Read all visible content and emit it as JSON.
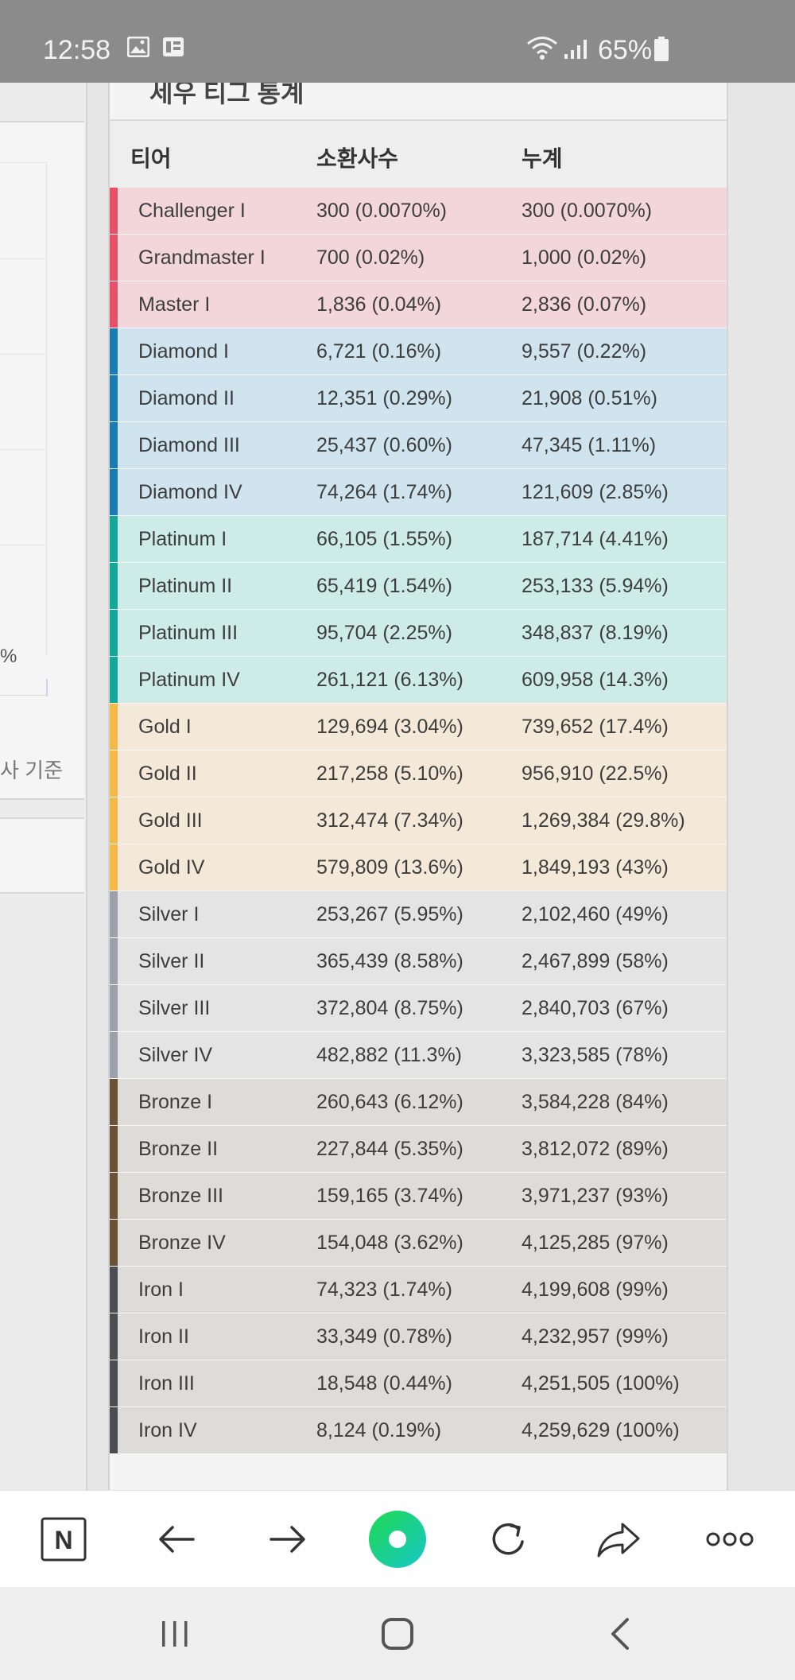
{
  "status_bar": {
    "time": "12:58",
    "battery": "65%",
    "icons": [
      "gallery-icon",
      "notification-icon",
      "wifi-icon",
      "signal-icon",
      "battery-icon"
    ]
  },
  "left_panel": {
    "percent_label": "%",
    "basis_label": "사 기준"
  },
  "card": {
    "title": "세우 티그 통계"
  },
  "table": {
    "headers": {
      "tier": "티어",
      "count": "소환사수",
      "cumulative": "누계"
    },
    "colors": {
      "challenger": {
        "bg": "#f2d6da",
        "stripe": "#e8506a"
      },
      "diamond": {
        "bg": "#cfe4ee",
        "stripe": "#1a7bb0"
      },
      "platinum": {
        "bg": "#cdece8",
        "stripe": "#13a899"
      },
      "gold": {
        "bg": "#f4e9d8",
        "stripe": "#f4b946"
      },
      "silver": {
        "bg": "#e4e4e4",
        "stripe": "#9aa1ad"
      },
      "bronze": {
        "bg": "#dedcd8",
        "stripe": "#6a5236"
      },
      "iron": {
        "bg": "#dedcd8",
        "stripe": "#4a4d52"
      }
    },
    "rows": [
      {
        "tier": "Challenger I",
        "count": "300 (0.0070%)",
        "cumulative": "300 (0.0070%)",
        "group": "challenger"
      },
      {
        "tier": "Grandmaster I",
        "count": "700 (0.02%)",
        "cumulative": "1,000 (0.02%)",
        "group": "challenger"
      },
      {
        "tier": "Master I",
        "count": "1,836 (0.04%)",
        "cumulative": "2,836 (0.07%)",
        "group": "challenger"
      },
      {
        "tier": "Diamond I",
        "count": "6,721 (0.16%)",
        "cumulative": "9,557 (0.22%)",
        "group": "diamond"
      },
      {
        "tier": "Diamond II",
        "count": "12,351 (0.29%)",
        "cumulative": "21,908 (0.51%)",
        "group": "diamond"
      },
      {
        "tier": "Diamond III",
        "count": "25,437 (0.60%)",
        "cumulative": "47,345 (1.11%)",
        "group": "diamond"
      },
      {
        "tier": "Diamond IV",
        "count": "74,264 (1.74%)",
        "cumulative": "121,609 (2.85%)",
        "group": "diamond"
      },
      {
        "tier": "Platinum I",
        "count": "66,105 (1.55%)",
        "cumulative": "187,714 (4.41%)",
        "group": "platinum"
      },
      {
        "tier": "Platinum II",
        "count": "65,419 (1.54%)",
        "cumulative": "253,133 (5.94%)",
        "group": "platinum"
      },
      {
        "tier": "Platinum III",
        "count": "95,704 (2.25%)",
        "cumulative": "348,837 (8.19%)",
        "group": "platinum"
      },
      {
        "tier": "Platinum IV",
        "count": "261,121 (6.13%)",
        "cumulative": "609,958 (14.3%)",
        "group": "platinum"
      },
      {
        "tier": "Gold I",
        "count": "129,694 (3.04%)",
        "cumulative": "739,652 (17.4%)",
        "group": "gold"
      },
      {
        "tier": "Gold II",
        "count": "217,258 (5.10%)",
        "cumulative": "956,910 (22.5%)",
        "group": "gold"
      },
      {
        "tier": "Gold III",
        "count": "312,474 (7.34%)",
        "cumulative": "1,269,384 (29.8%)",
        "group": "gold"
      },
      {
        "tier": "Gold IV",
        "count": "579,809 (13.6%)",
        "cumulative": "1,849,193 (43%)",
        "group": "gold"
      },
      {
        "tier": "Silver I",
        "count": "253,267 (5.95%)",
        "cumulative": "2,102,460 (49%)",
        "group": "silver"
      },
      {
        "tier": "Silver II",
        "count": "365,439 (8.58%)",
        "cumulative": "2,467,899 (58%)",
        "group": "silver"
      },
      {
        "tier": "Silver III",
        "count": "372,804 (8.75%)",
        "cumulative": "2,840,703 (67%)",
        "group": "silver"
      },
      {
        "tier": "Silver IV",
        "count": "482,882 (11.3%)",
        "cumulative": "3,323,585 (78%)",
        "group": "silver"
      },
      {
        "tier": "Bronze I",
        "count": "260,643 (6.12%)",
        "cumulative": "3,584,228 (84%)",
        "group": "bronze"
      },
      {
        "tier": "Bronze II",
        "count": "227,844 (5.35%)",
        "cumulative": "3,812,072 (89%)",
        "group": "bronze"
      },
      {
        "tier": "Bronze III",
        "count": "159,165 (3.74%)",
        "cumulative": "3,971,237 (93%)",
        "group": "bronze"
      },
      {
        "tier": "Bronze IV",
        "count": "154,048 (3.62%)",
        "cumulative": "4,125,285 (97%)",
        "group": "bronze"
      },
      {
        "tier": "Iron I",
        "count": "74,323 (1.74%)",
        "cumulative": "4,199,608 (99%)",
        "group": "iron"
      },
      {
        "tier": "Iron II",
        "count": "33,349 (0.78%)",
        "cumulative": "4,232,957 (99%)",
        "group": "iron"
      },
      {
        "tier": "Iron III",
        "count": "18,548 (0.44%)",
        "cumulative": "4,251,505 (100%)",
        "group": "iron"
      },
      {
        "tier": "Iron IV",
        "count": "8,124 (0.19%)",
        "cumulative": "4,259,629 (100%)",
        "group": "iron"
      }
    ]
  },
  "browser_toolbar": {
    "buttons": [
      "naver-home-icon",
      "back-arrow-icon",
      "forward-arrow-icon",
      "green-dot-icon",
      "refresh-icon",
      "share-icon",
      "more-icon"
    ],
    "brand_letter": "N",
    "accent": "#19ce60"
  },
  "nav_bar": {
    "buttons": [
      "recent-apps-icon",
      "home-icon",
      "back-icon"
    ]
  }
}
